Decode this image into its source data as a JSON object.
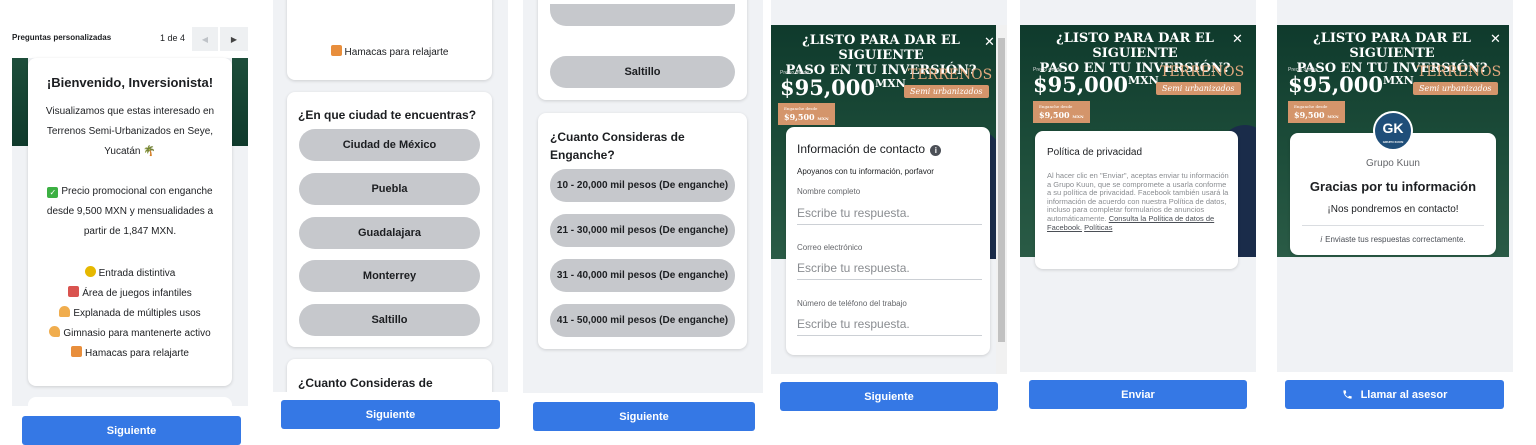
{
  "panel1": {
    "header_title": "Preguntas personalizadas",
    "page_indicator": "1 de 4",
    "prev_arrow": "◀",
    "next_arrow": "▶",
    "welcome_title": "¡Bienvenido, Inversionista!",
    "intro_1": "Visualizamos que estas interesado en",
    "intro_2": "Terrenos Semi-Urbanizados en Seye,",
    "intro_3": "Yucatán",
    "promo_1": "Precio promocional con enganche",
    "promo_2": "desde 9,500 MXN y mensualidades a",
    "promo_3": "partir de 1,847 MXN.",
    "amenities": [
      "Entrada distintiva",
      "Área de juegos infantiles",
      "Explanada de múltiples usos",
      "Gimnasio para mantenerte activo",
      "Hamacas para relajarte"
    ],
    "next_button": "Siguiente"
  },
  "panel2": {
    "top_amenity": "Hamacas para relajarte",
    "city_question": "¿En que ciudad te encuentras?",
    "cities": [
      "Ciudad de México",
      "Puebla",
      "Guadalajara",
      "Monterrey",
      "Saltillo"
    ],
    "enganche_question": "¿Cuanto Consideras de",
    "next_button": "Siguiente"
  },
  "panel3": {
    "top_option": "Saltillo",
    "enganche_question_1": "¿Cuanto Consideras de",
    "enganche_question_2": "Enganche?",
    "options": [
      "10 - 20,000 mil pesos (De enganche)",
      "21 - 30,000 mil pesos (De enganche)",
      "31 - 40,000 mil pesos (De enganche)",
      "41 - 50,000 mil pesos (De enganche)"
    ],
    "next_button": "Siguiente"
  },
  "ad": {
    "title_1": "¿LISTO PARA DAR EL SIGUIENTE",
    "title_2": "PASO EN TU INVERSIÓN?",
    "desde": "Precio desde",
    "price": "$95,000",
    "currency": "MXN",
    "terrenos": "TERRENOS",
    "semi": "Semi urbanizados",
    "enganche_label": "Enganche desde",
    "enganche_value": "$9,500",
    "enganche_currency": "MXN"
  },
  "panel4": {
    "close": "✕",
    "section_title": "Información de contacto",
    "subtitle": "Apoyanos con tu información, porfavor",
    "fields": [
      {
        "label": "Nombre completo",
        "placeholder": "Escribe tu respuesta."
      },
      {
        "label": "Correo electrónico",
        "placeholder": "Escribe tu respuesta."
      },
      {
        "label": "Número de teléfono del trabajo",
        "placeholder": "Escribe tu respuesta."
      }
    ],
    "next_button": "Siguiente"
  },
  "panel5": {
    "close": "✕",
    "privacy_title": "Política de privacidad",
    "privacy_text": "Al hacer clic en \"Enviar\", aceptas enviar tu información a Grupo Kuun, que se compromete a usarla conforme a su política de privacidad. Facebook también usará la información de acuerdo con nuestra Política de datos, incluso para completar formularios de anuncios automáticamente.",
    "link_1": "Consulta la Política de datos de Facebook.",
    "link_2": "Políticas",
    "submit_button": "Enviar"
  },
  "panel6": {
    "close": "✕",
    "logo_letters": "GK",
    "logo_sub": "GRUPO KUUN",
    "company": "Grupo Kuun",
    "thanks": "Gracias por tu información",
    "contact_msg": "¡Nos pondremos en contacto!",
    "sent_msg": "Enviaste tus respuestas correctamente.",
    "call_button": "Llamar al asesor"
  },
  "colors": {
    "primary": "#3578e5",
    "option_gray": "#c6c8cc",
    "bg_gray": "#f0f2f5"
  }
}
